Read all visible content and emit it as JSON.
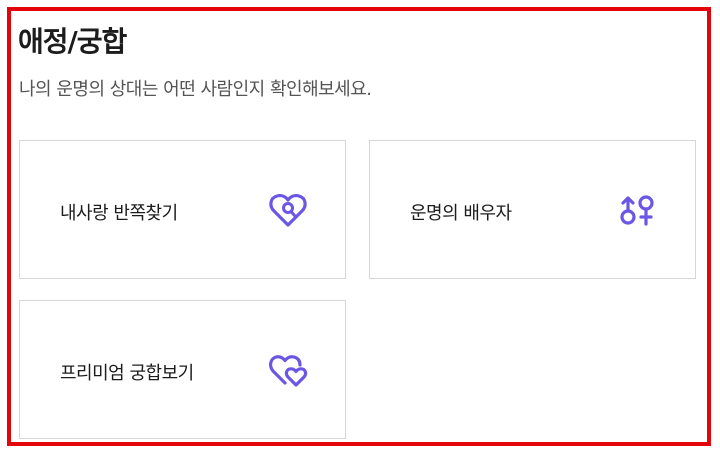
{
  "section": {
    "title": "애정/궁합",
    "subtitle": "나의 운명의 상대는 어떤 사람인지 확인해보세요."
  },
  "cards": [
    {
      "label": "내사랑 반쪽찾기",
      "icon": "heart-search-icon"
    },
    {
      "label": "운명의 배우자",
      "icon": "gender-symbols-icon"
    },
    {
      "label": "프리미엄 궁합보기",
      "icon": "double-heart-icon"
    }
  ],
  "colors": {
    "frame": "#e4050c",
    "accent": "#6b57e6",
    "text": "#1c1c1c",
    "subtext": "#555555",
    "card_border": "#d6d6d6"
  }
}
